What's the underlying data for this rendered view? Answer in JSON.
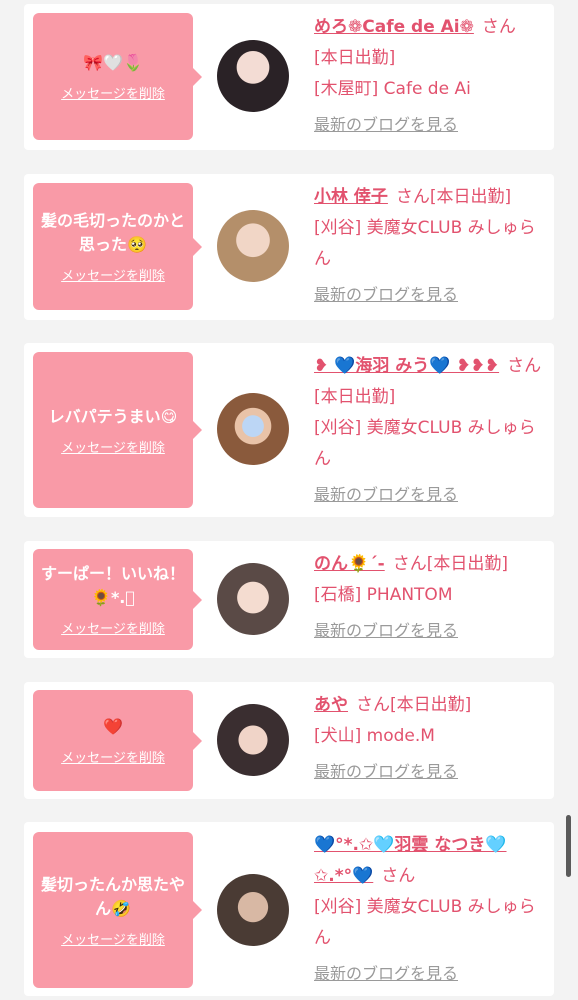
{
  "delete_label": "メッセージを削除",
  "blog_label": "最新のブログを見る",
  "honorific": "さん",
  "colors": {
    "bubble": "#f99aa7",
    "accent": "#e2526e",
    "link_gray": "#9a9a9a",
    "background": "#f3f3f3"
  },
  "items": [
    {
      "message": "🎀🤍🌷",
      "name": "めろ❁Cafe de Ai❁",
      "status": "[本日出勤]",
      "shop": "[木屋町] Cafe de Ai",
      "avatar": "avatar-photo"
    },
    {
      "message": "髪の毛切ったのかと思った🥺",
      "name": "小林 倖子",
      "status": "[本日出勤]",
      "shop": "[刈谷] 美魔女CLUB みしゅらん",
      "avatar": "avatar-photo"
    },
    {
      "message": "レバパテうまい😋",
      "name": "❥ 💙海羽 みう💙 ❥❥❥",
      "status": "[本日出勤]",
      "shop": "[刈谷] 美魔女CLUB みしゅらん",
      "avatar": "avatar-photo"
    },
    {
      "message": "すーぱー！いいね！🌻*.ﾟ",
      "name": "のん🌻´-",
      "status": "[本日出勤]",
      "shop": "[石橋] PHANTOM",
      "avatar": "avatar-photo"
    },
    {
      "message": "❤️",
      "name": "あや",
      "status": "[本日出勤]",
      "shop": "[犬山] mode.M",
      "avatar": "avatar-photo"
    },
    {
      "message": "髪切ったんか思たやん🤣",
      "name": "💙°*.✩🩵羽雲 なつき🩵✩.*°💙",
      "status": "",
      "shop": "[刈谷] 美魔女CLUB みしゅらん",
      "avatar": "avatar-photo"
    }
  ]
}
